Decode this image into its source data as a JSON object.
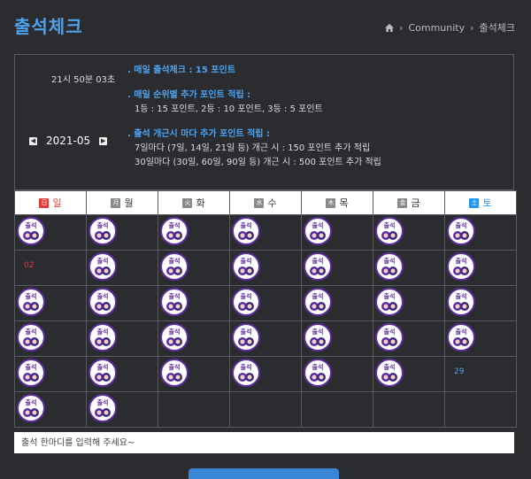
{
  "page": {
    "title": "출석체크"
  },
  "breadcrumb": {
    "home_icon": "home-icon",
    "items": [
      "Community",
      "출석체크"
    ]
  },
  "panel": {
    "time": "21시 50분 03초",
    "month": "2021-05",
    "info": [
      {
        "heading": ". 매일 출석체크 : 15 포인트",
        "lines": []
      },
      {
        "heading": ". 매일 순위별 추가 포인트 적립 :",
        "lines": [
          "1등 : 15 포인트,  2등 : 10 포인트,  3등 : 5 포인트"
        ]
      },
      {
        "heading": ". 출석 개근시 마다 추가 포인트 적립 :",
        "lines": [
          "7일마다 (7일, 14일, 21일 등) 개근 시 : 150 포인트 추가 적립",
          "30일마다 (30일, 60일, 90일 등) 개근 시 : 500 포인트 추가 적립"
        ]
      }
    ]
  },
  "calendar": {
    "days": [
      {
        "badge": "日",
        "name": "일",
        "kind": "sun"
      },
      {
        "badge": "月",
        "name": "월",
        "kind": ""
      },
      {
        "badge": "火",
        "name": "화",
        "kind": ""
      },
      {
        "badge": "水",
        "name": "수",
        "kind": ""
      },
      {
        "badge": "木",
        "name": "목",
        "kind": ""
      },
      {
        "badge": "金",
        "name": "금",
        "kind": ""
      },
      {
        "badge": "土",
        "name": "토",
        "kind": "sat"
      }
    ],
    "weeks": [
      [
        "stamp",
        "stamp",
        "stamp",
        "stamp",
        "stamp",
        "stamp",
        "stamp"
      ],
      [
        {
          "date": "02",
          "kind": "sun"
        },
        "stamp",
        "stamp",
        "stamp",
        "stamp",
        "stamp",
        "stamp"
      ],
      [
        "stamp",
        "stamp",
        "stamp",
        "stamp",
        "stamp",
        "stamp",
        "stamp"
      ],
      [
        "stamp",
        "stamp",
        "stamp",
        "stamp",
        "stamp",
        "stamp",
        "stamp"
      ],
      [
        "stamp",
        "stamp",
        "stamp",
        "stamp",
        "stamp",
        "stamp",
        {
          "date": "29",
          "kind": "sat"
        }
      ],
      [
        "stamp",
        "stamp",
        "",
        "",
        "",
        "",
        ""
      ]
    ]
  },
  "comment": {
    "placeholder": "출석 한마디를 입력해 주세요~"
  }
}
